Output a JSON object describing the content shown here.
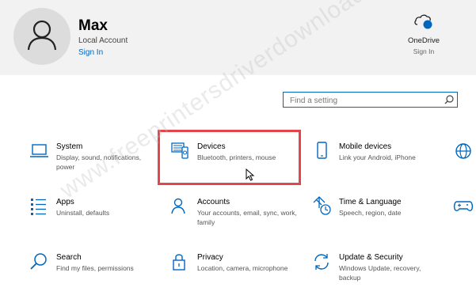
{
  "account": {
    "name": "Max",
    "type": "Local Account",
    "signin_label": "Sign In"
  },
  "onedrive": {
    "label": "OneDrive",
    "signin_label": "Sign In",
    "icon": "cloud-icon",
    "status_color": "#0067c0"
  },
  "search": {
    "placeholder": "Find a setting",
    "icon": "search-icon"
  },
  "categories": [
    {
      "title": "System",
      "description": "Display, sound, notifications, power",
      "icon": "laptop-icon"
    },
    {
      "title": "Devices",
      "description": "Bluetooth, printers, mouse",
      "icon": "devices-icon"
    },
    {
      "title": "Mobile devices",
      "description": "Link your Android, iPhone",
      "icon": "phone-icon"
    },
    {
      "title": "Apps",
      "description": "Uninstall, defaults",
      "icon": "apps-list-icon"
    },
    {
      "title": "Accounts",
      "description": "Your accounts, email, sync, work, family",
      "icon": "person-icon"
    },
    {
      "title": "Time & Language",
      "description": "Speech, region, date",
      "icon": "time-language-icon"
    },
    {
      "title": "Search",
      "description": "Find my files, permissions",
      "icon": "search-icon"
    },
    {
      "title": "Privacy",
      "description": "Location, camera, microphone",
      "icon": "lock-icon"
    },
    {
      "title": "Update & Security",
      "description": "Windows Update, recovery, backup",
      "icon": "sync-icon"
    }
  ],
  "edge_icons": [
    "globe-icon",
    "gamepad-icon"
  ],
  "watermark": "www.freeprintersdriverdownload.org",
  "colors": {
    "accent": "#0067c0",
    "highlight": "#e2454c",
    "header_bg": "#f2f2f2"
  }
}
